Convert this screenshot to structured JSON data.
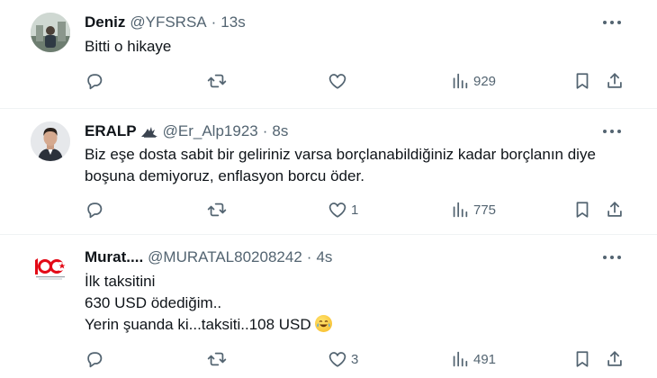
{
  "tweets": [
    {
      "name": "Deniz",
      "handle": "@YFSRSA",
      "separator": "·",
      "time": "13s",
      "lines": [
        "Bitti o hikaye"
      ],
      "reply_count": "",
      "retweet_count": "",
      "like_count": "",
      "views": "929"
    },
    {
      "name": "ERALP",
      "handle": "@Er_Alp1923",
      "separator": "·",
      "time": "8s",
      "lines": [
        "Biz eşe dosta sabit bir geliriniz varsa borçlanabildiğiniz kadar borçlanın diye",
        "boşuna demiyoruz, enflasyon borcu öder."
      ],
      "reply_count": "",
      "retweet_count": "",
      "like_count": "1",
      "views": "775"
    },
    {
      "name": "Murat....",
      "handle": "@MURATAL80208242",
      "separator": "·",
      "time": "4s",
      "lines": [
        "İlk taksitini",
        "630 USD ödediğim..",
        "Yerin şuanda ki...taksiti..108 USD"
      ],
      "reply_count": "",
      "retweet_count": "",
      "like_count": "3",
      "views": "491"
    }
  ],
  "icons": {
    "reply": "reply-icon",
    "retweet": "retweet-icon",
    "like": "heart-icon",
    "views": "views-bar-chart-icon",
    "bookmark": "bookmark-icon",
    "share": "share-icon",
    "more": "more-options-icon",
    "emoji": "face-with-tears-of-joy-emoji"
  },
  "colors": {
    "text": "#0f1419",
    "secondary": "#536471",
    "divider": "#eff3f4",
    "logo_red": "#e30a17"
  }
}
